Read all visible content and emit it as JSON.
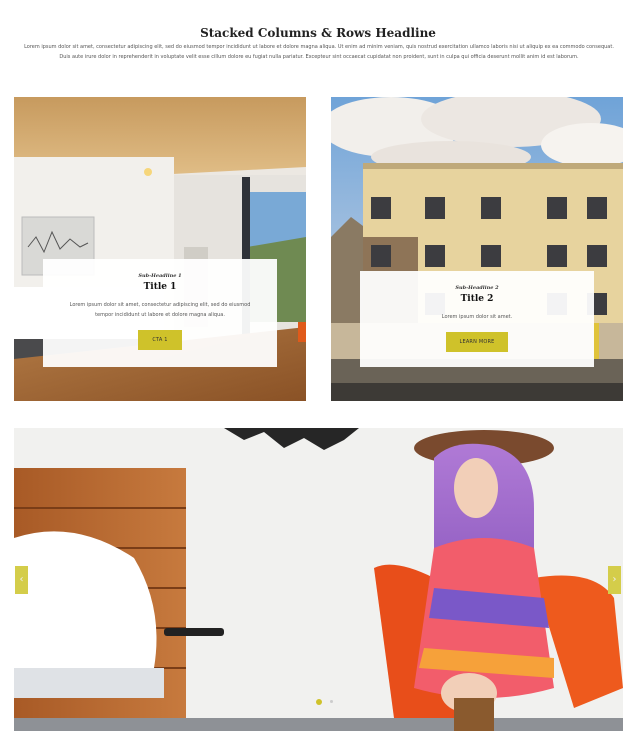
{
  "header": {
    "headline": "Stacked Columns & Rows Headline",
    "intro": "Lorem ipsum dolor sit amet, consectetur adipiscing elit, sed do eiusmod tempor incididunt ut labore et dolore magna aliqua. Ut enim ad minim veniam, quis nostrud exercitation ullamco laboris nisi ut aliquip ex ea commodo consequat. Duis aute irure dolor in reprehenderit in voluptate velit esse cillum dolore eu fugiat nulla pariatur. Excepteur sint occaecat cupidatat non proident, sunt in culpa qui officia deserunt mollit anim id est laborum."
  },
  "cards": [
    {
      "subheadline": "Sub-Headline 1",
      "title": "Title 1",
      "body": "Lorem ipsum dolor sit amet, consectetur adipiscing elit, sed do eiusmod tempor incididunt ut labore et dolore magna aliqua.",
      "button": "CTA 1"
    },
    {
      "subheadline": "Sub-Headline 2",
      "title": "Title 2",
      "body": "Lorem ipsum dolor sit amet.",
      "button": "LEARN MORE"
    }
  ],
  "slider": {
    "prev_icon": "chevron-left-icon",
    "next_icon": "chevron-right-icon",
    "prev_glyph": "‹",
    "next_glyph": "›",
    "slides": 2,
    "active_slide": 1
  },
  "colors": {
    "accent": "#cfc22a",
    "headline": "#222222"
  }
}
